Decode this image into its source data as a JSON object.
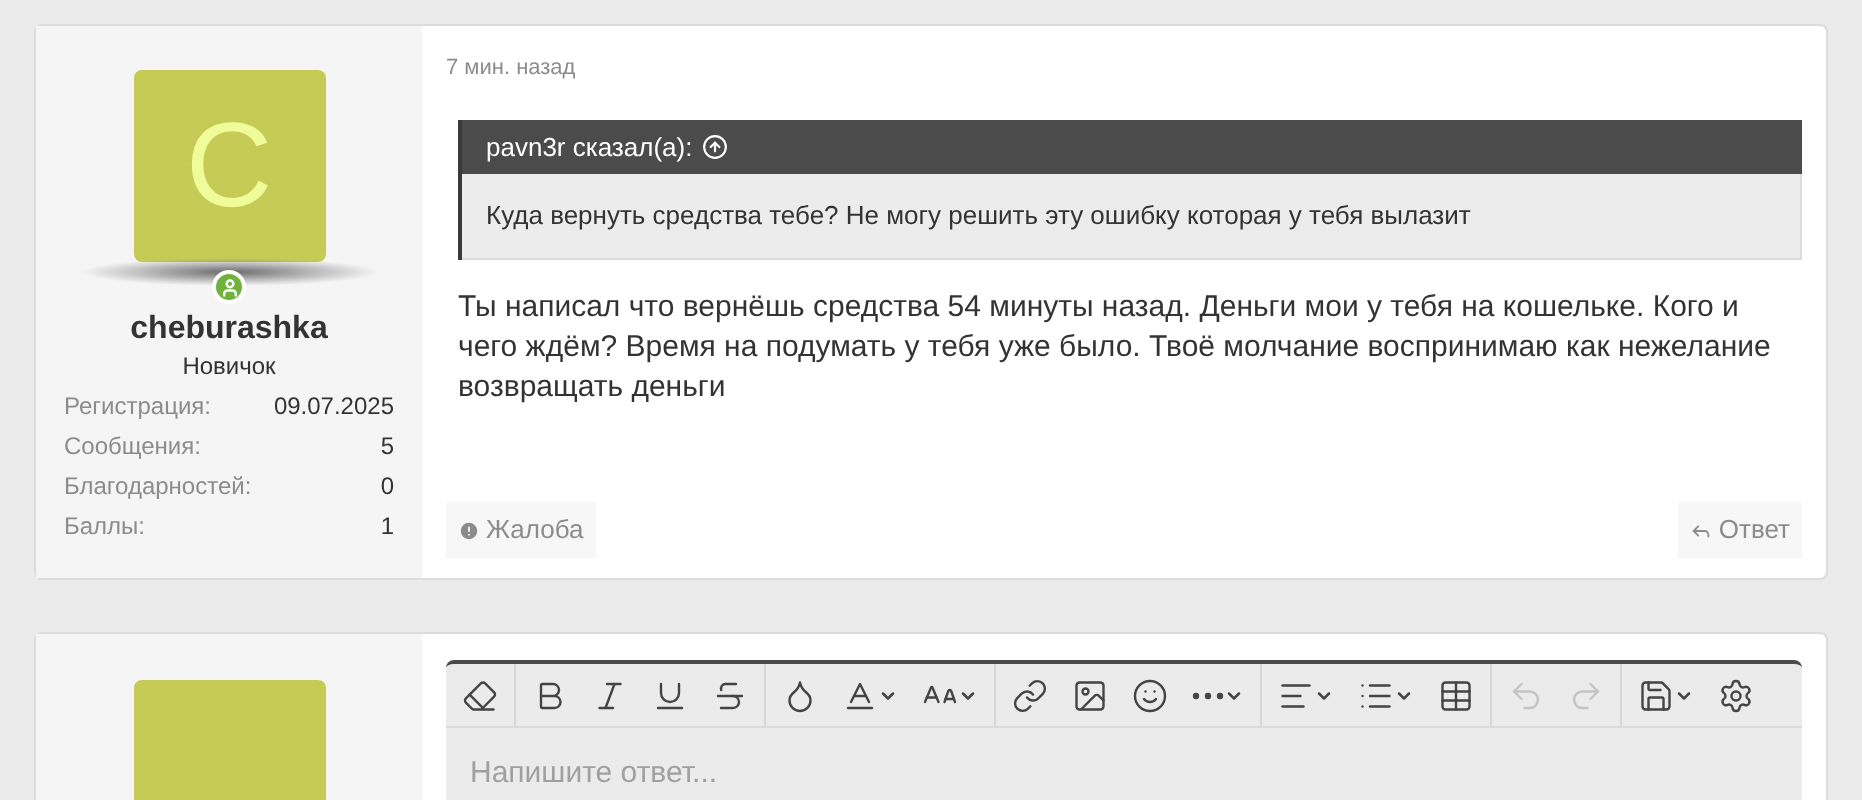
{
  "post": {
    "author": {
      "avatar_letter": "C",
      "online": true,
      "name": "cheburashka",
      "rank": "Новичок",
      "stats": [
        {
          "label": "Регистрация:",
          "value": "09.07.2025"
        },
        {
          "label": "Сообщения:",
          "value": "5"
        },
        {
          "label": "Благодарностей:",
          "value": "0"
        },
        {
          "label": "Баллы:",
          "value": "1"
        }
      ]
    },
    "time": "7 мин. назад",
    "quote": {
      "author": "pavn3r сказал(а):",
      "text": "Куда вернуть средства тебе? Не могу решить эту ошибку которая у тебя вылазит"
    },
    "message": "Ты написал что вернёшь средства 54 минуты назад. Деньги мои у тебя на кошельке. Кого и чего ждём? Время на подумать у тебя уже было. Твоё молчание воспринимаю как нежелание возвращать деньги",
    "actions": [
      {
        "label": "Жалоба"
      },
      {
        "label": "Ответ"
      }
    ]
  },
  "reply": {
    "toolbar": [
      {
        "disabled": false,
        "dropdown": false,
        "group_end": true
      },
      {
        "disabled": false,
        "dropdown": false,
        "group_end": false
      },
      {
        "disabled": false,
        "dropdown": false,
        "group_end": false
      },
      {
        "disabled": false,
        "dropdown": false,
        "group_end": false
      },
      {
        "disabled": false,
        "dropdown": false,
        "group_end": true
      },
      {
        "disabled": false,
        "dropdown": false,
        "group_end": false
      },
      {
        "disabled": false,
        "dropdown": true,
        "group_end": false
      },
      {
        "disabled": false,
        "dropdown": true,
        "group_end": true
      },
      {
        "disabled": false,
        "dropdown": false,
        "group_end": false
      },
      {
        "disabled": false,
        "dropdown": false,
        "group_end": false
      },
      {
        "disabled": false,
        "dropdown": false,
        "group_end": false
      },
      {
        "disabled": false,
        "dropdown": true,
        "group_end": true
      },
      {
        "disabled": false,
        "dropdown": true,
        "group_end": false
      },
      {
        "disabled": false,
        "dropdown": true,
        "group_end": false
      },
      {
        "disabled": false,
        "dropdown": false,
        "group_end": true
      },
      {
        "disabled": true,
        "dropdown": false,
        "group_end": false
      },
      {
        "disabled": true,
        "dropdown": false,
        "group_end": true
      },
      {
        "disabled": false,
        "dropdown": true,
        "group_end": false
      },
      {
        "disabled": false,
        "dropdown": false,
        "group_end": false
      }
    ],
    "placeholder": "Напишите ответ..."
  }
}
